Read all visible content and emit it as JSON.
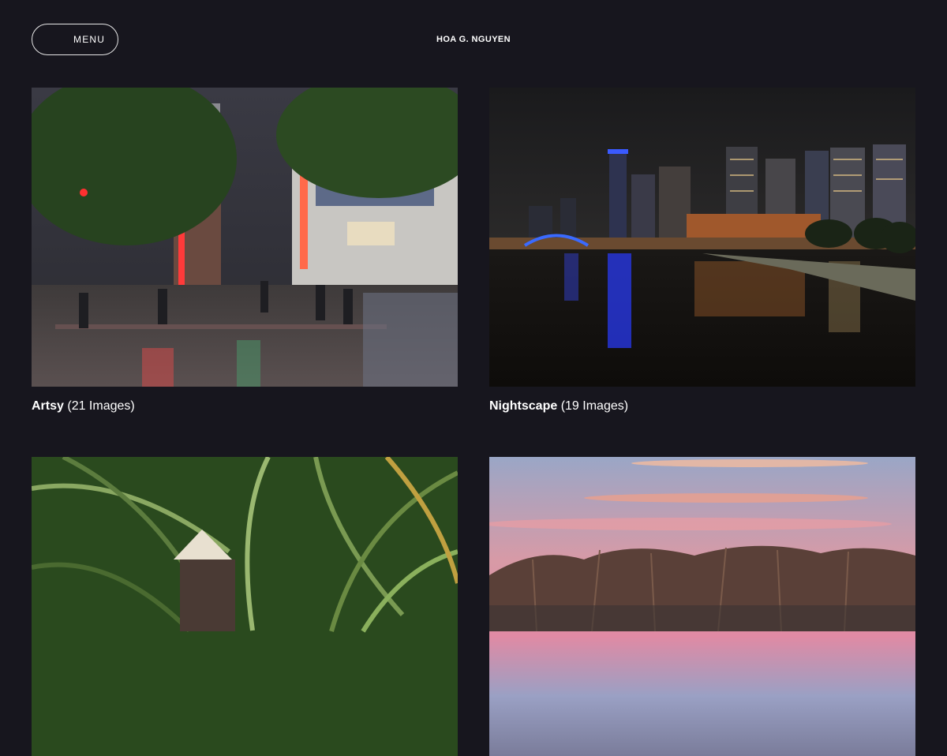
{
  "header": {
    "menu_label": "MENU",
    "site_title": "HOA G. NGUYEN"
  },
  "galleries": [
    {
      "name": "Artsy",
      "count": "(21 Images)",
      "image": "rainy-city-street-at-night"
    },
    {
      "name": "Nightscape",
      "count": "(19 Images)",
      "image": "city-skyline-river-night"
    },
    {
      "name": "",
      "count": "",
      "image": "palm-garden-person-conical-hat"
    },
    {
      "name": "",
      "count": "",
      "image": "pink-sunset-over-reeds-water"
    }
  ]
}
